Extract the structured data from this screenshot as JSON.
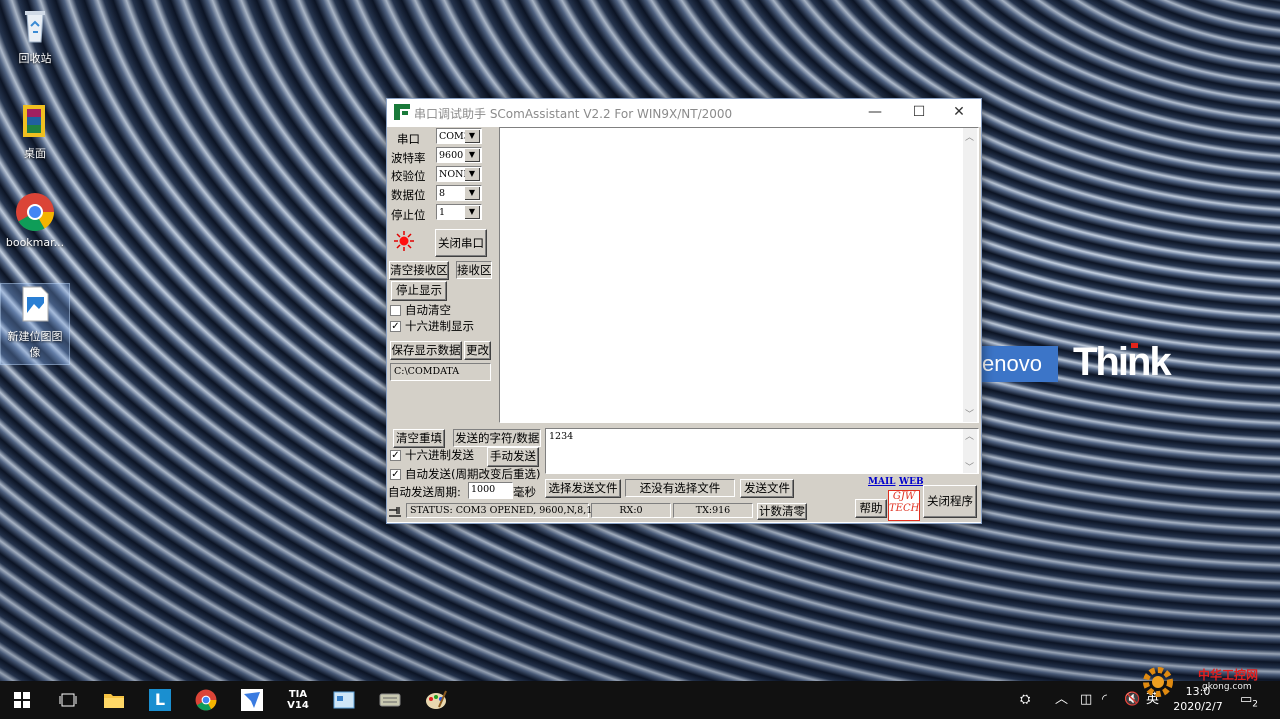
{
  "desktop": {
    "icons": [
      {
        "label": "回收站"
      },
      {
        "label": "桌面"
      },
      {
        "label": "bookmar..."
      },
      {
        "label": "新建位图图像"
      }
    ],
    "wallpaper_brand": {
      "lenovo": "enovo",
      "think": "Think"
    }
  },
  "window": {
    "title": "串口调试助手 SComAssistant V2.2 For WIN9X/NT/2000",
    "controls": {
      "minimize": "—",
      "maximize": "☐",
      "close": "✕"
    },
    "settings": {
      "port_label": "串口",
      "port_value": "COM3",
      "baud_label": "波特率",
      "baud_value": "9600",
      "parity_label": "校验位",
      "parity_value": "NONE",
      "databits_label": "数据位",
      "databits_value": "8",
      "stopbits_label": "停止位",
      "stopbits_value": "1"
    },
    "close_port_button": "关闭串口",
    "clear_receive_button": "清空接收区",
    "receive_area_label": "接收区",
    "stop_display_button": "停止显示",
    "auto_clear_label": "自动清空",
    "auto_clear_checked": false,
    "hex_display_label": "十六进制显示",
    "hex_display_checked": true,
    "save_data_button": "保存显示数据",
    "change_button": "更改",
    "save_path": "C:\\COMDATA",
    "receive_text": "",
    "send": {
      "clear_resend_button": "清空重填",
      "send_chars_label": "发送的字符/数据",
      "send_text": "1234",
      "hex_send_label": "十六进制发送",
      "hex_send_checked": true,
      "manual_send_button": "手动发送",
      "auto_send_label": "自动发送(周期改变后重选)",
      "auto_send_checked": true,
      "period_label": "自动发送周期:",
      "period_value": "1000",
      "period_unit": "毫秒",
      "select_file_button": "选择发送文件",
      "file_status": "还没有选择文件",
      "send_file_button": "发送文件"
    },
    "links": {
      "mail": "MAIL",
      "web": "WEB"
    },
    "help_button": "帮助",
    "logo_text_top": "GJW",
    "logo_text_bottom": "TECH",
    "close_program_button": "关闭程序",
    "status": {
      "status_text": "STATUS: COM3 OPENED, 9600,N,8,1",
      "rx": "RX:0",
      "tx": "TX:916",
      "reset_count_button": "计数清零"
    }
  },
  "taskbar": {
    "apps": [
      "start-icon",
      "task-view-icon",
      "file-explorer-icon",
      "l-app-icon",
      "chrome-icon",
      "feishu-icon",
      "tia-portal-icon",
      "app-window-icon",
      "keyboard-icon",
      "paint-icon"
    ],
    "tia_label": "TIA\nV14",
    "l_label": "L",
    "ime": "英",
    "time": "13:0",
    "date": "2020/2/7",
    "notification_count": "2"
  },
  "watermark": {
    "text": "中华工控网",
    "url": "gkong.com"
  },
  "colors": {
    "accent_blue": "#3c75c8",
    "think_red": "#e2231a",
    "panel_grey": "#d4d0c8",
    "logo_red": "#e03020"
  }
}
